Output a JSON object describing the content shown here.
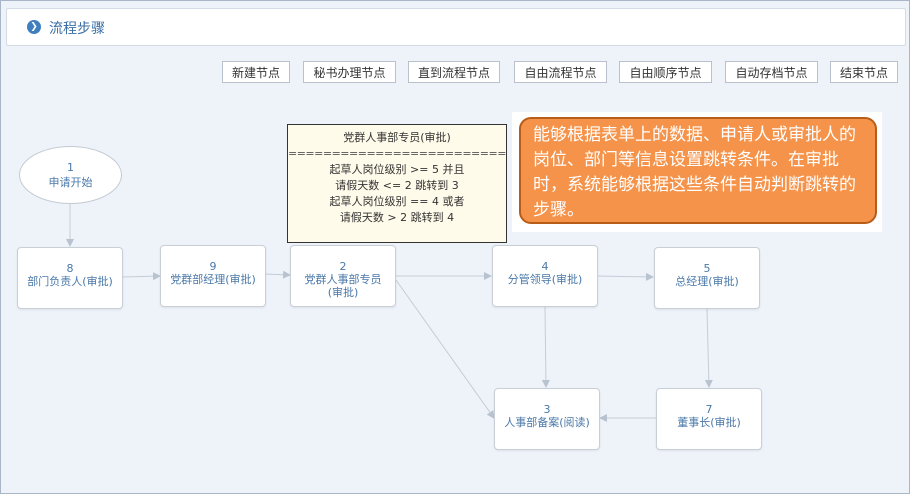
{
  "header": {
    "title": "流程步骤"
  },
  "toolbar": {
    "buttons": [
      "新建节点",
      "秘书办理节点",
      "直到流程节点",
      "自由流程节点",
      "自由顺序节点",
      "自动存档节点",
      "结束节点"
    ]
  },
  "nodes": {
    "n1": {
      "num": "1",
      "label": "申请开始"
    },
    "n8": {
      "num": "8",
      "label": "部门负责人(审批)"
    },
    "n9": {
      "num": "9",
      "label": "党群部经理(审批)"
    },
    "n2": {
      "num": "2",
      "label": "党群人事部专员(审批)"
    },
    "n4": {
      "num": "4",
      "label": "分管领导(审批)"
    },
    "n5": {
      "num": "5",
      "label": "总经理(审批)"
    },
    "n3": {
      "num": "3",
      "label": "人事部备案(阅读)"
    },
    "n7": {
      "num": "7",
      "label": "董事长(审批)"
    }
  },
  "condition": {
    "title": "党群人事部专员(审批)",
    "separator": "===========================",
    "lines": [
      "起草人岗位级别 >= 5 并且",
      "请假天数 <= 2 跳转到 3",
      "起草人岗位级别 == 4 或者",
      "请假天数 > 2 跳转到 4"
    ]
  },
  "callout": {
    "text": "能够根据表单上的数据、申请人或审批人的岗位、部门等信息设置跳转条件。在审批时，系统能够根据这些条件自动判断跳转的步骤。"
  },
  "colors": {
    "accent": "#3f7fc0",
    "callout_bg": "#f5934a",
    "callout_border": "#b85d18",
    "condition_bg": "#fffbea"
  }
}
